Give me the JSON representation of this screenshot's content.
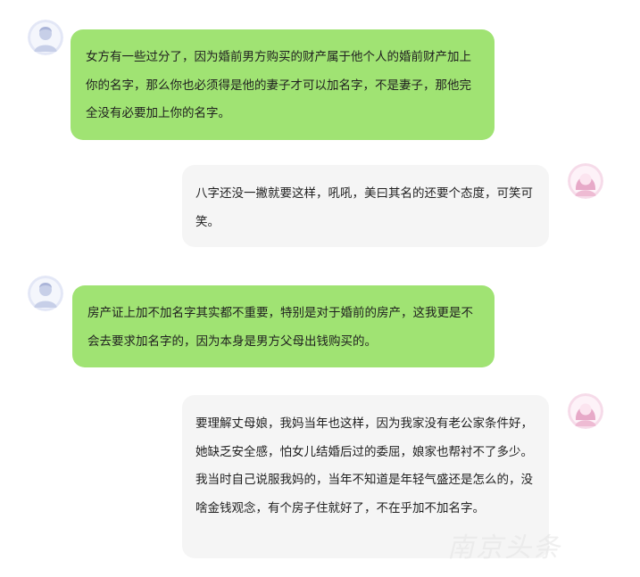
{
  "messages": [
    {
      "side": "left",
      "avatar": "male-user-avatar-icon",
      "text": "女方有一些过分了，因为婚前男方购买的财产属于他个人的婚前财产加上你的名字，那么你也必须得是他的妻子才可以加名字，不是妻子，那他完全没有必要加上你的名字。"
    },
    {
      "side": "right",
      "avatar": "female-user-avatar-icon",
      "text": "八字还没一撇就要这样，吼吼，美曰其名的还要个态度，可笑可笑。"
    },
    {
      "side": "left",
      "avatar": "male-user-avatar-icon",
      "text": "房产证上加不加名字其实都不重要，特别是对于婚前的房产，这我更是不会去要求加名字的，因为本身是男方父母出钱购买的。"
    },
    {
      "side": "right",
      "avatar": "female-user-avatar-icon",
      "text": "要理解丈母娘，我妈当年也这样，因为我家没有老公家条件好，她缺乏安全感，怕女儿结婚后过的委屈，娘家也帮衬不了多少。我当时自己说服我妈的，当年不知道是年轻气盛还是怎么的，没啥金钱观念，有个房子住就好了，不在乎加不加名字。"
    }
  ],
  "watermark": "南京头条",
  "colors": {
    "left_bubble": "#a0e373",
    "right_bubble": "#f5f5f5",
    "text": "#1f1f1f"
  }
}
